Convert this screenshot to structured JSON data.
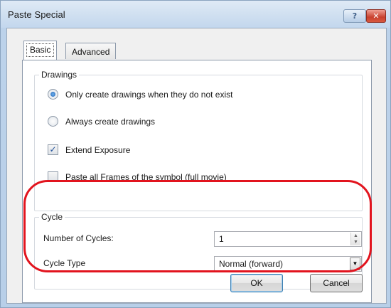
{
  "window": {
    "title": "Paste Special",
    "help_glyph": "?",
    "close_glyph": "✕"
  },
  "tabs": [
    {
      "label": "Basic",
      "selected": true
    },
    {
      "label": "Advanced",
      "selected": false
    }
  ],
  "drawings": {
    "legend": "Drawings",
    "radio_only_create": {
      "label": "Only create drawings when they do not exist",
      "checked": true
    },
    "radio_always_create": {
      "label": "Always create drawings",
      "checked": false
    },
    "check_extend_exposure": {
      "label": "Extend Exposure",
      "checked": true,
      "glyph": "✓"
    },
    "check_paste_all_frames": {
      "label": "Paste all Frames of the symbol (full movie)",
      "checked": false
    }
  },
  "cycle": {
    "legend": "Cycle",
    "number_of_cycles": {
      "label": "Number of Cycles:",
      "value": "1"
    },
    "cycle_type": {
      "label": "Cycle Type",
      "value": "Normal (forward)"
    }
  },
  "buttons": {
    "ok": "OK",
    "cancel": "Cancel"
  },
  "annotation": {
    "highlight_color": "#e2141e"
  }
}
